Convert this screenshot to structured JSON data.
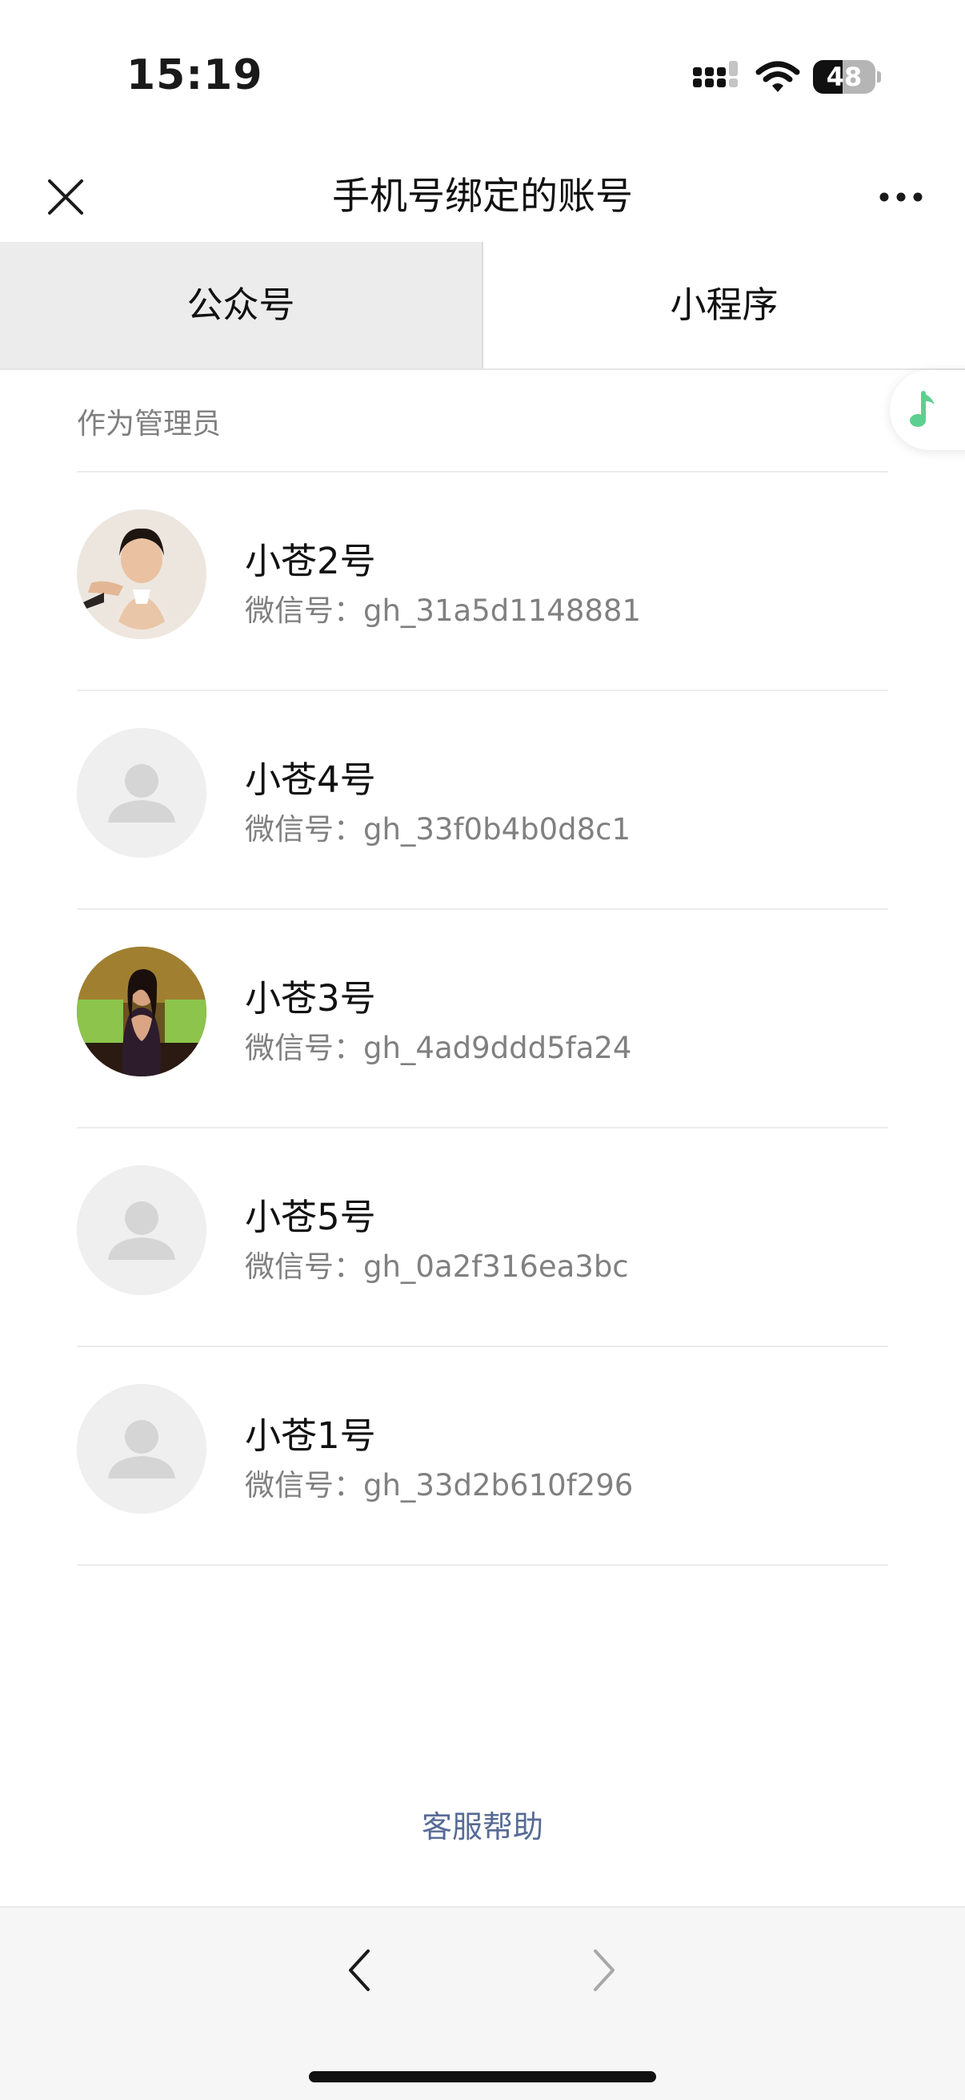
{
  "status_bar": {
    "time": "15:19",
    "battery_level": "48",
    "battery_percent": 48,
    "icons": [
      "signal-icon",
      "wifi-icon",
      "battery-icon"
    ]
  },
  "nav": {
    "title": "手机号绑定的账号",
    "close_icon": "close-icon",
    "more_icon": "more-icon"
  },
  "tabs": [
    {
      "label": "公众号",
      "active": true
    },
    {
      "label": "小程序",
      "active": false
    }
  ],
  "floating": {
    "icon": "music-note-icon",
    "color": "#5dcf8e"
  },
  "section": {
    "header": "作为管理员"
  },
  "accounts": [
    {
      "name": "小苍2号",
      "id_label": "微信号：gh_31a5d1148881",
      "avatar": "photo-avatar"
    },
    {
      "name": "小苍4号",
      "id_label": "微信号：gh_33f0b4b0d8c1",
      "avatar": "default-avatar-icon"
    },
    {
      "name": "小苍3号",
      "id_label": "微信号：gh_4ad9ddd5fa24",
      "avatar": "photo-avatar"
    },
    {
      "name": "小苍5号",
      "id_label": "微信号：gh_0a2f316ea3bc",
      "avatar": "default-avatar-icon"
    },
    {
      "name": "小苍1号",
      "id_label": "微信号：gh_33d2b610f296",
      "avatar": "default-avatar-icon"
    }
  ],
  "help": {
    "label": "客服帮助",
    "color": "#576b95"
  },
  "toolbar": {
    "back_icon": "chevron-left-icon",
    "forward_icon": "chevron-right-icon"
  }
}
